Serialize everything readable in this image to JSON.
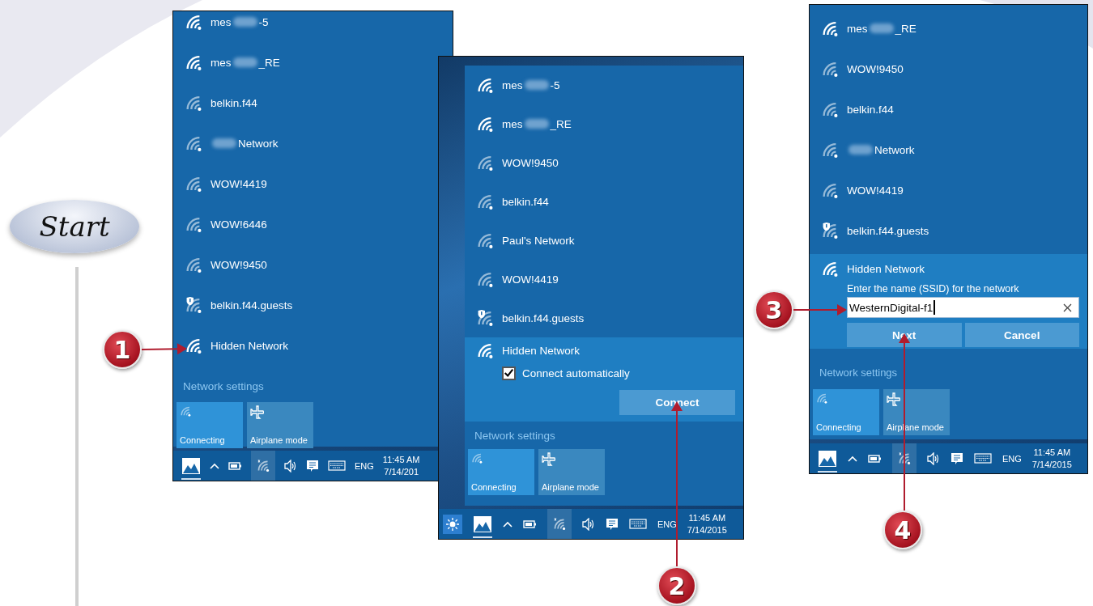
{
  "start_badge": "Start",
  "panels": [
    {
      "networks": [
        {
          "name": "mes",
          "blurred": true,
          "suffix": "-5",
          "strong_signal": true,
          "shield": false
        },
        {
          "name": "mes",
          "blurred": true,
          "suffix": "_RE",
          "strong_signal": true,
          "shield": false
        },
        {
          "name": "belkin.f44",
          "blurred": false,
          "strong_signal": false,
          "shield": false
        },
        {
          "blurred": true,
          "suffix": "Network",
          "strong_signal": false,
          "shield": false
        },
        {
          "name": "WOW!4419",
          "blurred": false,
          "strong_signal": false,
          "shield": false
        },
        {
          "name": "WOW!6446",
          "blurred": false,
          "strong_signal": false,
          "shield": false
        },
        {
          "name": "WOW!9450",
          "blurred": false,
          "strong_signal": false,
          "shield": false
        },
        {
          "name": "belkin.f44.guests",
          "blurred": false,
          "strong_signal": false,
          "shield": true
        },
        {
          "name": "Hidden Network",
          "blurred": false,
          "strong_signal": true,
          "shield": false
        }
      ],
      "settings_link": "Network settings",
      "tiles": [
        {
          "label": "Connecting",
          "kind": "wifi",
          "active": true
        },
        {
          "label": "Airplane mode",
          "kind": "airplane",
          "active": false
        }
      ],
      "taskbar": {
        "brightness_button": false,
        "language": "ENG",
        "time": "11:45 AM",
        "date": "7/14/201"
      }
    },
    {
      "networks": [
        {
          "name": "mes",
          "blurred": true,
          "suffix": "-5",
          "strong_signal": true,
          "shield": false
        },
        {
          "name": "mes",
          "blurred": true,
          "suffix": "_RE",
          "strong_signal": true,
          "shield": false
        },
        {
          "name": "WOW!9450",
          "blurred": false,
          "strong_signal": false,
          "shield": false
        },
        {
          "name": "belkin.f44",
          "blurred": false,
          "strong_signal": false,
          "shield": false
        },
        {
          "name": "Paul's Network",
          "blurred": false,
          "strong_signal": false,
          "shield": false
        },
        {
          "name": "WOW!4419",
          "blurred": false,
          "strong_signal": false,
          "shield": false
        },
        {
          "name": "belkin.f44.guests",
          "blurred": false,
          "strong_signal": false,
          "shield": true
        }
      ],
      "expanded": {
        "kind": "connect",
        "name": "Hidden Network",
        "checkbox": {
          "label": "Connect automatically",
          "checked": true
        },
        "button": "Connect"
      },
      "settings_link": "Network settings",
      "tiles": [
        {
          "label": "Connecting",
          "kind": "wifi",
          "active": true
        },
        {
          "label": "Airplane mode",
          "kind": "airplane",
          "active": false
        }
      ],
      "taskbar": {
        "brightness_button": true,
        "language": "ENG",
        "time": "11:45 AM",
        "date": "7/14/2015"
      }
    },
    {
      "networks": [
        {
          "name": "mes",
          "blurred": true,
          "suffix": "_RE",
          "strong_signal": true,
          "shield": false
        },
        {
          "name": "WOW!9450",
          "blurred": false,
          "strong_signal": false,
          "shield": false
        },
        {
          "name": "belkin.f44",
          "blurred": false,
          "strong_signal": false,
          "shield": false
        },
        {
          "blurred": true,
          "suffix": "Network",
          "strong_signal": false,
          "shield": false
        },
        {
          "name": "WOW!4419",
          "blurred": false,
          "strong_signal": false,
          "shield": false
        },
        {
          "name": "belkin.f44.guests",
          "blurred": false,
          "strong_signal": false,
          "shield": true
        }
      ],
      "expanded": {
        "kind": "ssid",
        "name": "Hidden Network",
        "prompt": "Enter the name (SSID) for the network",
        "value": "WesternDigital-f1",
        "buttons": [
          "Next",
          "Cancel"
        ]
      },
      "settings_link": "Network settings",
      "tiles": [
        {
          "label": "Connecting",
          "kind": "wifi",
          "active": true
        },
        {
          "label": "Airplane mode",
          "kind": "airplane",
          "active": false
        }
      ],
      "taskbar": {
        "brightness_button": false,
        "language": "ENG",
        "time": "11:45 AM",
        "date": "7/14/2015"
      }
    }
  ],
  "callouts": [
    {
      "number": "1"
    },
    {
      "number": "2"
    },
    {
      "number": "3"
    },
    {
      "number": "4"
    }
  ]
}
